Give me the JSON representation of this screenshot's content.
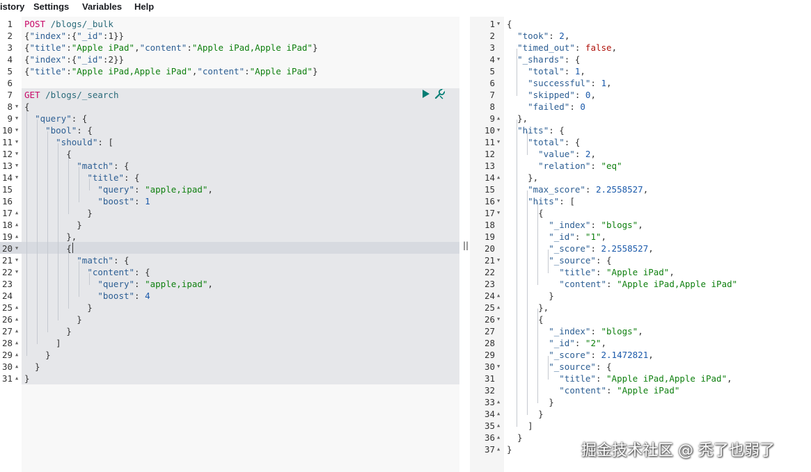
{
  "menu": {
    "history": "istory",
    "settings": "Settings",
    "variables": "Variables",
    "help": "Help"
  },
  "request_editor": {
    "actions": {
      "run": "play-icon",
      "settings": "wrench-icon"
    },
    "lines": [
      {
        "n": "1",
        "fold": "",
        "tokens": [
          [
            "m",
            "POST"
          ],
          [
            "p",
            " "
          ],
          [
            "u",
            "/blogs/_bulk"
          ]
        ]
      },
      {
        "n": "2",
        "fold": "",
        "tokens": [
          [
            "p",
            "{"
          ],
          [
            "k",
            "\"index\""
          ],
          [
            "p",
            ":{"
          ],
          [
            "k",
            "\"_id\""
          ],
          [
            "p",
            ":1}}"
          ]
        ]
      },
      {
        "n": "3",
        "fold": "",
        "tokens": [
          [
            "p",
            "{"
          ],
          [
            "k",
            "\"title\""
          ],
          [
            "p",
            ":"
          ],
          [
            "s",
            "\"Apple iPad\""
          ],
          [
            "p",
            ","
          ],
          [
            "k",
            "\"content\""
          ],
          [
            "p",
            ":"
          ],
          [
            "s",
            "\"Apple iPad,Apple iPad\""
          ],
          [
            "p",
            "}"
          ]
        ]
      },
      {
        "n": "4",
        "fold": "",
        "tokens": [
          [
            "p",
            "{"
          ],
          [
            "k",
            "\"index\""
          ],
          [
            "p",
            ":{"
          ],
          [
            "k",
            "\"_id\""
          ],
          [
            "p",
            ":2}}"
          ]
        ]
      },
      {
        "n": "5",
        "fold": "",
        "tokens": [
          [
            "p",
            "{"
          ],
          [
            "k",
            "\"title\""
          ],
          [
            "p",
            ":"
          ],
          [
            "s",
            "\"Apple iPad,Apple iPad\""
          ],
          [
            "p",
            ","
          ],
          [
            "k",
            "\"content\""
          ],
          [
            "p",
            ":"
          ],
          [
            "s",
            "\"Apple iPad\""
          ],
          [
            "p",
            "}"
          ]
        ]
      },
      {
        "n": "6",
        "fold": "",
        "tokens": []
      },
      {
        "n": "7",
        "fold": "",
        "tokens": [
          [
            "m",
            "GET"
          ],
          [
            "p",
            " "
          ],
          [
            "u",
            "/blogs/_search"
          ]
        ]
      },
      {
        "n": "8",
        "fold": "down",
        "tokens": [
          [
            "p",
            "{"
          ]
        ]
      },
      {
        "n": "9",
        "fold": "down",
        "tokens": [
          [
            "p",
            "  "
          ],
          [
            "k",
            "\"query\""
          ],
          [
            "p",
            ": {"
          ]
        ]
      },
      {
        "n": "10",
        "fold": "down",
        "tokens": [
          [
            "p",
            "    "
          ],
          [
            "k",
            "\"bool\""
          ],
          [
            "p",
            ": {"
          ]
        ]
      },
      {
        "n": "11",
        "fold": "down",
        "tokens": [
          [
            "p",
            "      "
          ],
          [
            "k",
            "\"should\""
          ],
          [
            "p",
            ": ["
          ]
        ]
      },
      {
        "n": "12",
        "fold": "down",
        "tokens": [
          [
            "p",
            "        {"
          ]
        ]
      },
      {
        "n": "13",
        "fold": "down",
        "tokens": [
          [
            "p",
            "          "
          ],
          [
            "k",
            "\"match\""
          ],
          [
            "p",
            ": {"
          ]
        ]
      },
      {
        "n": "14",
        "fold": "down",
        "tokens": [
          [
            "p",
            "            "
          ],
          [
            "k",
            "\"title\""
          ],
          [
            "p",
            ": {"
          ]
        ]
      },
      {
        "n": "15",
        "fold": "",
        "tokens": [
          [
            "p",
            "              "
          ],
          [
            "k",
            "\"query\""
          ],
          [
            "p",
            ": "
          ],
          [
            "s",
            "\"apple,ipad\""
          ],
          [
            "p",
            ","
          ]
        ]
      },
      {
        "n": "16",
        "fold": "",
        "tokens": [
          [
            "p",
            "              "
          ],
          [
            "k",
            "\"boost\""
          ],
          [
            "p",
            ": "
          ],
          [
            "n",
            "1"
          ]
        ]
      },
      {
        "n": "17",
        "fold": "up",
        "tokens": [
          [
            "p",
            "            }"
          ]
        ]
      },
      {
        "n": "18",
        "fold": "up",
        "tokens": [
          [
            "p",
            "          }"
          ]
        ]
      },
      {
        "n": "19",
        "fold": "up",
        "tokens": [
          [
            "p",
            "        },"
          ]
        ]
      },
      {
        "n": "20",
        "fold": "down",
        "tokens": [
          [
            "p",
            "        {"
          ]
        ]
      },
      {
        "n": "21",
        "fold": "down",
        "tokens": [
          [
            "p",
            "          "
          ],
          [
            "k",
            "\"match\""
          ],
          [
            "p",
            ": {"
          ]
        ]
      },
      {
        "n": "22",
        "fold": "down",
        "tokens": [
          [
            "p",
            "            "
          ],
          [
            "k",
            "\"content\""
          ],
          [
            "p",
            ": {"
          ]
        ]
      },
      {
        "n": "23",
        "fold": "",
        "tokens": [
          [
            "p",
            "              "
          ],
          [
            "k",
            "\"query\""
          ],
          [
            "p",
            ": "
          ],
          [
            "s",
            "\"apple,ipad\""
          ],
          [
            "p",
            ","
          ]
        ]
      },
      {
        "n": "24",
        "fold": "",
        "tokens": [
          [
            "p",
            "              "
          ],
          [
            "k",
            "\"boost\""
          ],
          [
            "p",
            ": "
          ],
          [
            "n",
            "4"
          ]
        ]
      },
      {
        "n": "25",
        "fold": "up",
        "tokens": [
          [
            "p",
            "            }"
          ]
        ]
      },
      {
        "n": "26",
        "fold": "up",
        "tokens": [
          [
            "p",
            "          }"
          ]
        ]
      },
      {
        "n": "27",
        "fold": "up",
        "tokens": [
          [
            "p",
            "        }"
          ]
        ]
      },
      {
        "n": "28",
        "fold": "up",
        "tokens": [
          [
            "p",
            "      ]"
          ]
        ]
      },
      {
        "n": "29",
        "fold": "up",
        "tokens": [
          [
            "p",
            "    }"
          ]
        ]
      },
      {
        "n": "30",
        "fold": "up",
        "tokens": [
          [
            "p",
            "  }"
          ]
        ]
      },
      {
        "n": "31",
        "fold": "up",
        "tokens": [
          [
            "p",
            "}"
          ]
        ]
      }
    ]
  },
  "response_viewer": {
    "lines": [
      {
        "n": "1",
        "fold": "down",
        "tokens": [
          [
            "p",
            "{"
          ]
        ]
      },
      {
        "n": "2",
        "fold": "",
        "tokens": [
          [
            "p",
            "  "
          ],
          [
            "k",
            "\"took\""
          ],
          [
            "p",
            ": "
          ],
          [
            "n",
            "2"
          ],
          [
            "p",
            ","
          ]
        ]
      },
      {
        "n": "3",
        "fold": "",
        "tokens": [
          [
            "p",
            "  "
          ],
          [
            "k",
            "\"timed_out\""
          ],
          [
            "p",
            ": "
          ],
          [
            "b",
            "false"
          ],
          [
            "p",
            ","
          ]
        ]
      },
      {
        "n": "4",
        "fold": "down",
        "tokens": [
          [
            "p",
            "  "
          ],
          [
            "k",
            "\"_shards\""
          ],
          [
            "p",
            ": {"
          ]
        ]
      },
      {
        "n": "5",
        "fold": "",
        "tokens": [
          [
            "p",
            "    "
          ],
          [
            "k",
            "\"total\""
          ],
          [
            "p",
            ": "
          ],
          [
            "n",
            "1"
          ],
          [
            "p",
            ","
          ]
        ]
      },
      {
        "n": "6",
        "fold": "",
        "tokens": [
          [
            "p",
            "    "
          ],
          [
            "k",
            "\"successful\""
          ],
          [
            "p",
            ": "
          ],
          [
            "n",
            "1"
          ],
          [
            "p",
            ","
          ]
        ]
      },
      {
        "n": "7",
        "fold": "",
        "tokens": [
          [
            "p",
            "    "
          ],
          [
            "k",
            "\"skipped\""
          ],
          [
            "p",
            ": "
          ],
          [
            "n",
            "0"
          ],
          [
            "p",
            ","
          ]
        ]
      },
      {
        "n": "8",
        "fold": "",
        "tokens": [
          [
            "p",
            "    "
          ],
          [
            "k",
            "\"failed\""
          ],
          [
            "p",
            ": "
          ],
          [
            "n",
            "0"
          ]
        ]
      },
      {
        "n": "9",
        "fold": "up",
        "tokens": [
          [
            "p",
            "  },"
          ]
        ]
      },
      {
        "n": "10",
        "fold": "down",
        "tokens": [
          [
            "p",
            "  "
          ],
          [
            "k",
            "\"hits\""
          ],
          [
            "p",
            ": {"
          ]
        ]
      },
      {
        "n": "11",
        "fold": "down",
        "tokens": [
          [
            "p",
            "    "
          ],
          [
            "k",
            "\"total\""
          ],
          [
            "p",
            ": {"
          ]
        ]
      },
      {
        "n": "12",
        "fold": "",
        "tokens": [
          [
            "p",
            "      "
          ],
          [
            "k",
            "\"value\""
          ],
          [
            "p",
            ": "
          ],
          [
            "n",
            "2"
          ],
          [
            "p",
            ","
          ]
        ]
      },
      {
        "n": "13",
        "fold": "",
        "tokens": [
          [
            "p",
            "      "
          ],
          [
            "k",
            "\"relation\""
          ],
          [
            "p",
            ": "
          ],
          [
            "s",
            "\"eq\""
          ]
        ]
      },
      {
        "n": "14",
        "fold": "up",
        "tokens": [
          [
            "p",
            "    },"
          ]
        ]
      },
      {
        "n": "15",
        "fold": "",
        "tokens": [
          [
            "p",
            "    "
          ],
          [
            "k",
            "\"max_score\""
          ],
          [
            "p",
            ": "
          ],
          [
            "n",
            "2.2558527"
          ],
          [
            "p",
            ","
          ]
        ]
      },
      {
        "n": "16",
        "fold": "down",
        "tokens": [
          [
            "p",
            "    "
          ],
          [
            "k",
            "\"hits\""
          ],
          [
            "p",
            ": ["
          ]
        ]
      },
      {
        "n": "17",
        "fold": "down",
        "tokens": [
          [
            "p",
            "      {"
          ]
        ]
      },
      {
        "n": "18",
        "fold": "",
        "tokens": [
          [
            "p",
            "        "
          ],
          [
            "k",
            "\"_index\""
          ],
          [
            "p",
            ": "
          ],
          [
            "s",
            "\"blogs\""
          ],
          [
            "p",
            ","
          ]
        ]
      },
      {
        "n": "19",
        "fold": "",
        "tokens": [
          [
            "p",
            "        "
          ],
          [
            "k",
            "\"_id\""
          ],
          [
            "p",
            ": "
          ],
          [
            "s",
            "\"1\""
          ],
          [
            "p",
            ","
          ]
        ]
      },
      {
        "n": "20",
        "fold": "",
        "tokens": [
          [
            "p",
            "        "
          ],
          [
            "k",
            "\"_score\""
          ],
          [
            "p",
            ": "
          ],
          [
            "n",
            "2.2558527"
          ],
          [
            "p",
            ","
          ]
        ]
      },
      {
        "n": "21",
        "fold": "down",
        "tokens": [
          [
            "p",
            "        "
          ],
          [
            "k",
            "\"_source\""
          ],
          [
            "p",
            ": {"
          ]
        ]
      },
      {
        "n": "22",
        "fold": "",
        "tokens": [
          [
            "p",
            "          "
          ],
          [
            "k",
            "\"title\""
          ],
          [
            "p",
            ": "
          ],
          [
            "s",
            "\"Apple iPad\""
          ],
          [
            "p",
            ","
          ]
        ]
      },
      {
        "n": "23",
        "fold": "",
        "tokens": [
          [
            "p",
            "          "
          ],
          [
            "k",
            "\"content\""
          ],
          [
            "p",
            ": "
          ],
          [
            "s",
            "\"Apple iPad,Apple iPad\""
          ]
        ]
      },
      {
        "n": "24",
        "fold": "up",
        "tokens": [
          [
            "p",
            "        }"
          ]
        ]
      },
      {
        "n": "25",
        "fold": "up",
        "tokens": [
          [
            "p",
            "      },"
          ]
        ]
      },
      {
        "n": "26",
        "fold": "down",
        "tokens": [
          [
            "p",
            "      {"
          ]
        ]
      },
      {
        "n": "27",
        "fold": "",
        "tokens": [
          [
            "p",
            "        "
          ],
          [
            "k",
            "\"_index\""
          ],
          [
            "p",
            ": "
          ],
          [
            "s",
            "\"blogs\""
          ],
          [
            "p",
            ","
          ]
        ]
      },
      {
        "n": "28",
        "fold": "",
        "tokens": [
          [
            "p",
            "        "
          ],
          [
            "k",
            "\"_id\""
          ],
          [
            "p",
            ": "
          ],
          [
            "s",
            "\"2\""
          ],
          [
            "p",
            ","
          ]
        ]
      },
      {
        "n": "29",
        "fold": "",
        "tokens": [
          [
            "p",
            "        "
          ],
          [
            "k",
            "\"_score\""
          ],
          [
            "p",
            ": "
          ],
          [
            "n",
            "2.1472821"
          ],
          [
            "p",
            ","
          ]
        ]
      },
      {
        "n": "30",
        "fold": "down",
        "tokens": [
          [
            "p",
            "        "
          ],
          [
            "k",
            "\"_source\""
          ],
          [
            "p",
            ": {"
          ]
        ]
      },
      {
        "n": "31",
        "fold": "",
        "tokens": [
          [
            "p",
            "          "
          ],
          [
            "k",
            "\"title\""
          ],
          [
            "p",
            ": "
          ],
          [
            "s",
            "\"Apple iPad,Apple iPad\""
          ],
          [
            "p",
            ","
          ]
        ]
      },
      {
        "n": "32",
        "fold": "",
        "tokens": [
          [
            "p",
            "          "
          ],
          [
            "k",
            "\"content\""
          ],
          [
            "p",
            ": "
          ],
          [
            "s",
            "\"Apple iPad\""
          ]
        ]
      },
      {
        "n": "33",
        "fold": "up",
        "tokens": [
          [
            "p",
            "        }"
          ]
        ]
      },
      {
        "n": "34",
        "fold": "up",
        "tokens": [
          [
            "p",
            "      }"
          ]
        ]
      },
      {
        "n": "35",
        "fold": "up",
        "tokens": [
          [
            "p",
            "    ]"
          ]
        ]
      },
      {
        "n": "36",
        "fold": "up",
        "tokens": [
          [
            "p",
            "  }"
          ]
        ]
      },
      {
        "n": "37",
        "fold": "up",
        "tokens": [
          [
            "p",
            "}"
          ]
        ]
      }
    ]
  },
  "watermark": "掘金技术社区 @ 秃了也弱了",
  "colors": {
    "method": "#c80a68",
    "url": "#2a6b7a",
    "key": "#2c5e93",
    "string": "#108010",
    "number": "#1a59aa",
    "boolean": "#b0140d",
    "run_button": "#017d73",
    "active_line": "#d7dae0",
    "request_block": "#e6e7ea"
  }
}
